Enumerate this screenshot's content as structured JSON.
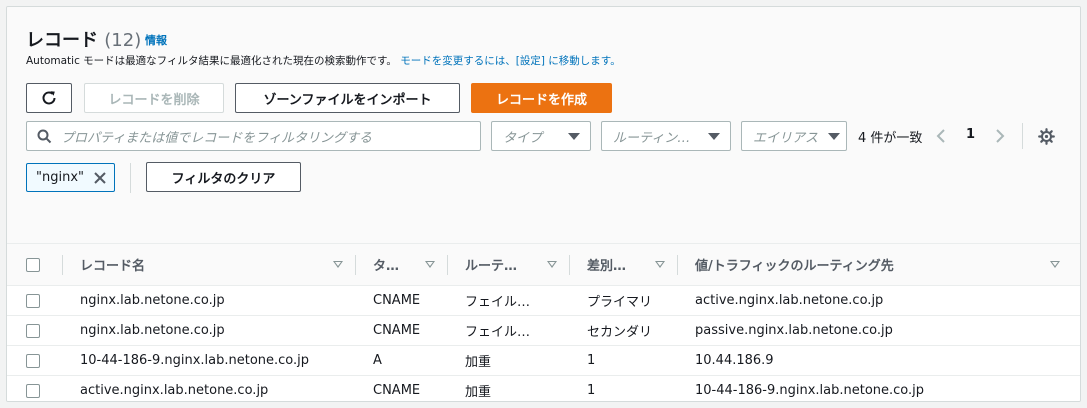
{
  "header": {
    "title": "レコード",
    "count": "(12)",
    "info_link": "情報",
    "description_text": "Automatic モードは最適なフィルタ結果に最適化された現在の検索動作です。",
    "description_link": "モードを変更するには、[設定] に移動します。"
  },
  "toolbar": {
    "delete_label": "レコードを削除",
    "import_label": "ゾーンファイルをインポート",
    "create_label": "レコードを作成"
  },
  "filter": {
    "search_placeholder": "プロパティまたは値でレコードをフィルタリングする",
    "type_select": "タイプ",
    "routing_select": "ルーティン…",
    "alias_select": "エイリアス",
    "match_count": "4 件が一致",
    "page": "1",
    "token": "\"nginx\"",
    "clear_label": "フィルタのクリア"
  },
  "table": {
    "columns": [
      "レコード名",
      "タ…",
      "ルーテ…",
      "差別…",
      "値/トラフィックのルーティング先"
    ],
    "rows": [
      {
        "name": "nginx.lab.netone.co.jp",
        "type": "CNAME",
        "routing": "フェイル…",
        "diff": "プライマリ",
        "value": "active.nginx.lab.netone.co.jp"
      },
      {
        "name": "nginx.lab.netone.co.jp",
        "type": "CNAME",
        "routing": "フェイル…",
        "diff": "セカンダリ",
        "value": "passive.nginx.lab.netone.co.jp"
      },
      {
        "name": "10-44-186-9.nginx.lab.netone.co.jp",
        "type": "A",
        "routing": "加重",
        "diff": "1",
        "value": "10.44.186.9"
      },
      {
        "name": "active.nginx.lab.netone.co.jp",
        "type": "CNAME",
        "routing": "加重",
        "diff": "1",
        "value": "10-44-186-9.nginx.lab.netone.co.jp"
      }
    ]
  },
  "colors": {
    "primary": "#ec7211",
    "link": "#0073bb"
  },
  "icons": [
    "refresh-icon",
    "search-icon",
    "chevron-left-icon",
    "chevron-right-icon",
    "gear-icon",
    "close-icon"
  ]
}
